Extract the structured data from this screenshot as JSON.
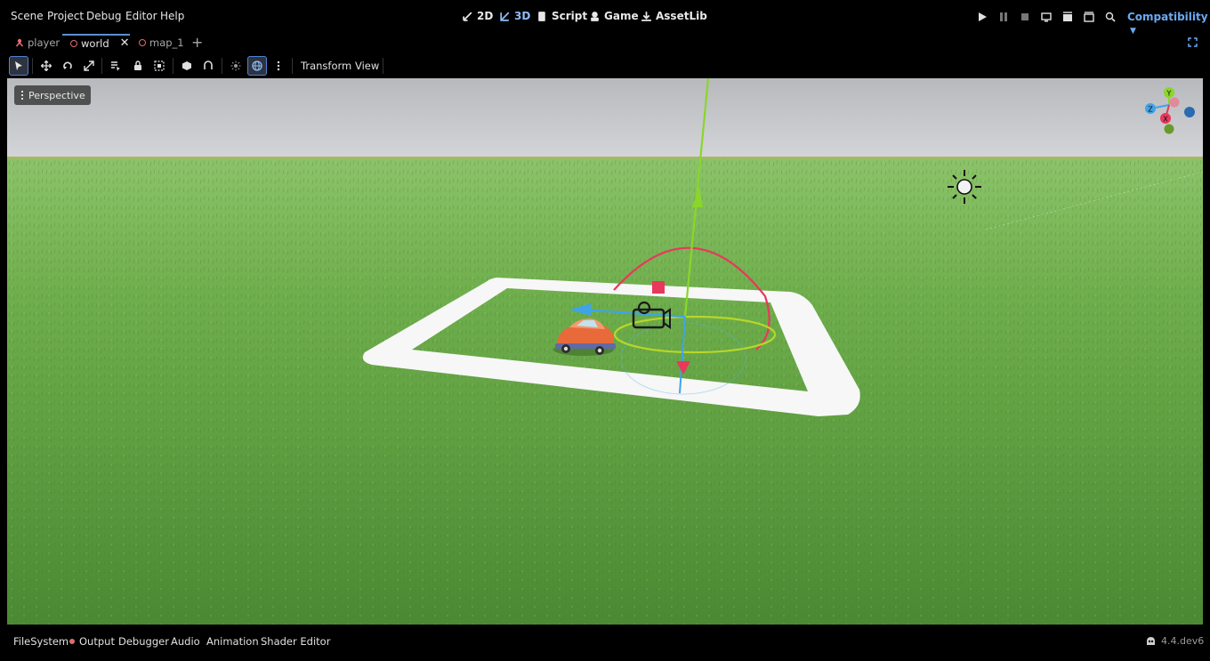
{
  "menu": [
    "Scene",
    "Project",
    "Debug",
    "Editor",
    "Help"
  ],
  "workspaces": {
    "w2d": "2D",
    "w3d": "3D",
    "script": "Script",
    "game": "Game",
    "assetlib": "AssetLib"
  },
  "renderer": "Compatibility",
  "scene_tabs": {
    "player": "player",
    "world": "world",
    "map": "map_1"
  },
  "toolbar": {
    "transform": "Transform",
    "view": "View"
  },
  "viewport": {
    "perspective": "Perspective",
    "gizmo_axes": {
      "x": "X",
      "y": "Y",
      "z": "Z"
    }
  },
  "bottom_tabs": {
    "filesystem": "FileSystem",
    "output": "Output",
    "debugger": "Debugger",
    "audio": "Audio",
    "animation": "Animation",
    "shader_editor": "Shader Editor"
  },
  "version": "4.4.dev6",
  "colors": {
    "accent": "#6aaaf2",
    "x_axis": "#e8385c",
    "y_axis": "#8ad62a",
    "z_axis": "#3fa3e8",
    "grass": "#5e9a3a",
    "sky": "#c9cbd0"
  }
}
